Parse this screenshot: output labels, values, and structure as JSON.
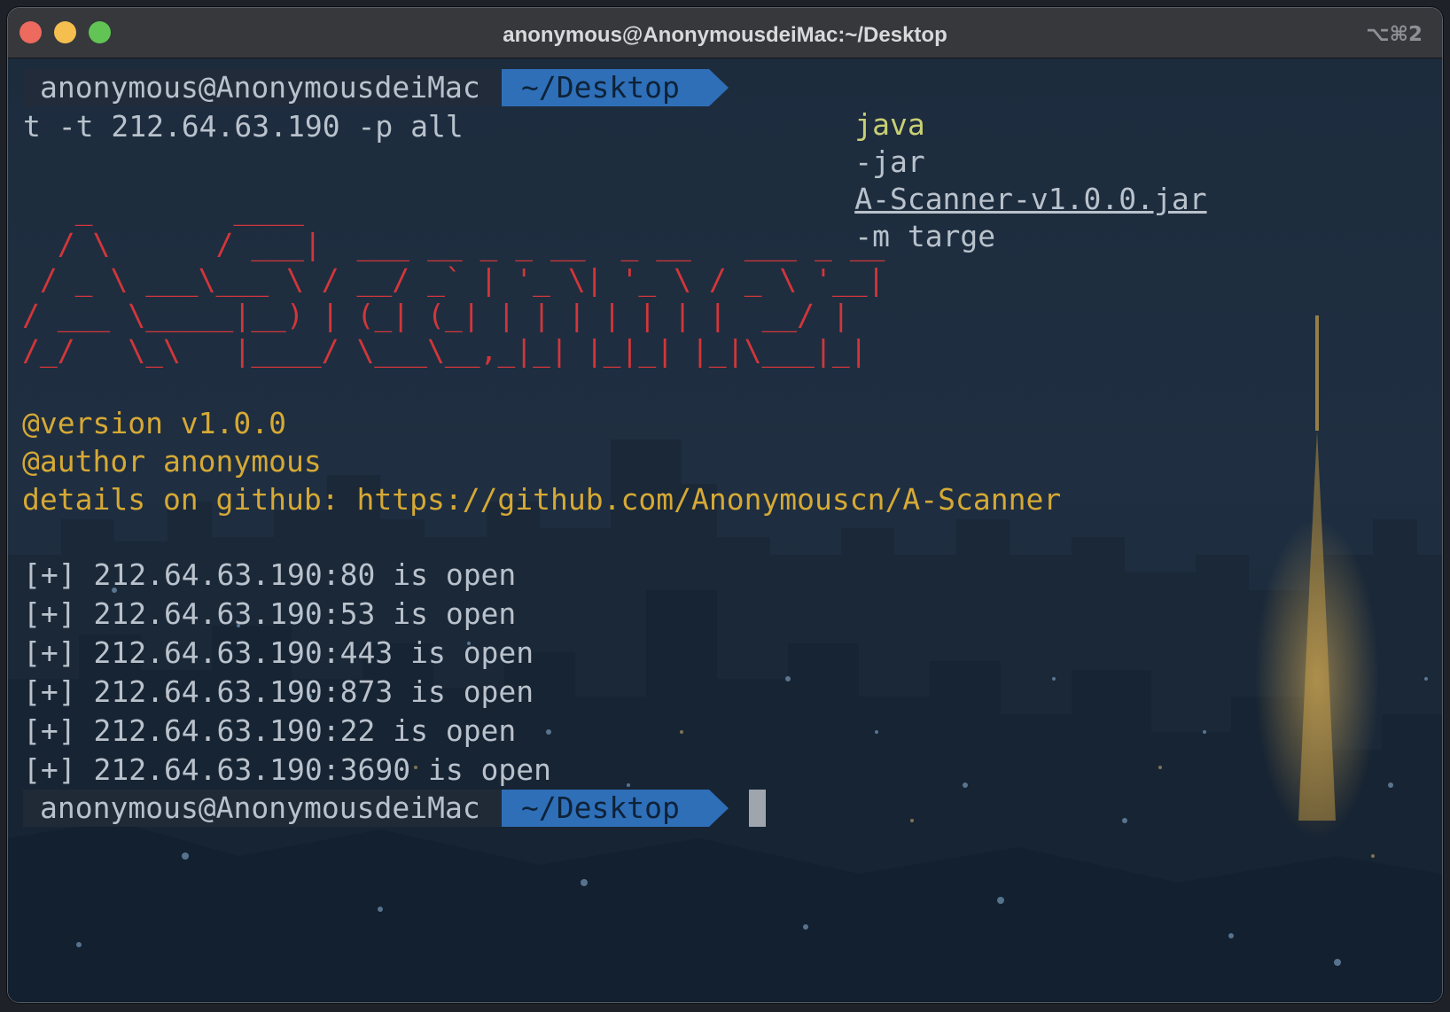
{
  "window": {
    "title": "anonymous@AnonymousdeiMac:~/Desktop",
    "shortcut": "⌥⌘2"
  },
  "prompt": {
    "user": "anonymous@AnonymousdeiMac",
    "dir": "~/Desktop"
  },
  "command": {
    "program": "java",
    "flag_jar": "-jar",
    "jar_file": "A-Scanner-v1.0.0.jar",
    "rest_line1": "-m targe",
    "line2": "t -t 212.64.63.190 -p all"
  },
  "banner": {
    "ascii_lines": [
      "   _        ____",
      "  / \\      / ___|  ___ __ _ _ __  _ __   ___ _ __",
      " / _ \\ ___\\___ \\ / __/ _` | '_ \\| '_ \\ / _ \\ '__|",
      "/ ___ \\_____|__) | (_| (_| | | | | | | |  __/ |",
      "/_/   \\_\\   |____/ \\___\\__,_|_| |_|_| |_|\\___|_|"
    ],
    "version": "@version v1.0.0",
    "author": "@author anonymous",
    "details": "details on github: https://github.com/Anonymouscn/A-Scanner"
  },
  "results": [
    "[+] 212.64.63.190:80 is open",
    "[+] 212.64.63.190:53 is open",
    "[+] 212.64.63.190:443 is open",
    "[+] 212.64.63.190:873 is open",
    "[+] 212.64.63.190:22 is open",
    "[+] 212.64.63.190:3690 is open"
  ],
  "colors": {
    "banner": "#d2363a",
    "info": "#d6a935",
    "command": "#c8cf74",
    "prompt_dir_bg": "#2e6fb8",
    "text": "#b9c2cc"
  }
}
